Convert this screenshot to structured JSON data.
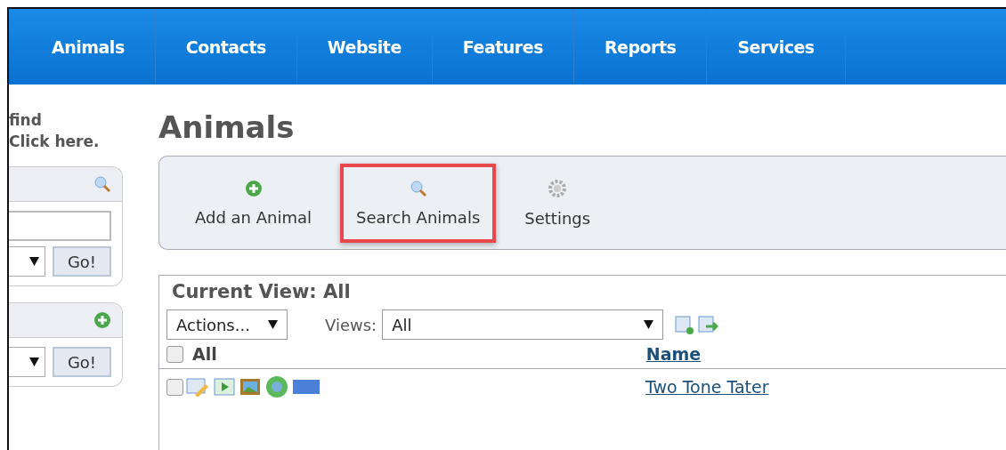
{
  "nav": [
    {
      "label": "Animals"
    },
    {
      "label": "Contacts"
    },
    {
      "label": "Website"
    },
    {
      "label": "Features"
    },
    {
      "label": "Reports"
    },
    {
      "label": "Services"
    }
  ],
  "sidebar": {
    "intro_lines": [
      "find",
      "Click here."
    ],
    "boxes": [
      {
        "kind": "search",
        "button": "Go!"
      },
      {
        "kind": "add",
        "button": "Go!"
      }
    ]
  },
  "page_title": "Animals",
  "toolbar": [
    {
      "kind": "add",
      "label": "Add an Animal",
      "highlighted": false
    },
    {
      "kind": "search",
      "label": "Search Animals",
      "highlighted": true
    },
    {
      "kind": "settings",
      "label": "Settings",
      "highlighted": false
    }
  ],
  "view": {
    "title": "Current View: All",
    "actions": "Actions...",
    "views_label": "Views:",
    "views_value": "All",
    "columns": [
      {
        "label": "All",
        "checked": false
      },
      {
        "label": "Name"
      }
    ],
    "rows": [
      {
        "checked": false,
        "name": "Two Tone Tater"
      }
    ]
  }
}
